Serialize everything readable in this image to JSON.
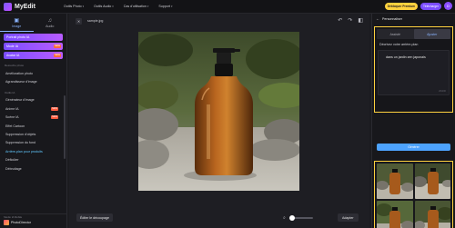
{
  "app": {
    "name": "MyEdit"
  },
  "nav": [
    {
      "label": "Outils Photo"
    },
    {
      "label": "Outils Audio"
    },
    {
      "label": "Cas d'utilisation"
    },
    {
      "label": "Support"
    }
  ],
  "top_actions": {
    "premium": "Débloquer Premium",
    "download": "Télécharger",
    "avatar_initial": "D"
  },
  "sidebar": {
    "tabs": [
      {
        "label": "Image",
        "icon": "image-icon",
        "active": true
      },
      {
        "label": "Audio",
        "icon": "audio-icon",
        "active": false
      }
    ],
    "highlights": [
      {
        "label": "Portrait photo IA",
        "badge": ""
      },
      {
        "label": "Mode IA",
        "badge": "NEW"
      },
      {
        "label": "Avatar IA",
        "badge": "NEW"
      }
    ],
    "section_retouche": "Retouche photo",
    "retouche_items": [
      {
        "label": "Amélioration photo"
      },
      {
        "label": "Agrandisseur d'image"
      }
    ],
    "section_ia": "Outils IA",
    "ia_items": [
      {
        "label": "Générateur d'image",
        "badge": "",
        "active": false
      },
      {
        "label": "Anime IA",
        "badge": "NEW",
        "active": false
      },
      {
        "label": "Scène IA",
        "badge": "NEW",
        "active": false
      },
      {
        "label": "Effet Cartoon",
        "badge": "",
        "active": false
      },
      {
        "label": "Suppression d'objets",
        "badge": "",
        "active": false
      },
      {
        "label": "Suppression du fond",
        "badge": "",
        "active": false
      },
      {
        "label": "Arrière-plan pour produits",
        "badge": "",
        "active": true
      },
      {
        "label": "Défloûter",
        "badge": "",
        "active": false
      },
      {
        "label": "Débruitage",
        "badge": "",
        "active": false
      }
    ],
    "footer_label": "Studio IA Mobile",
    "footer_app": "PhotoDirector"
  },
  "editor": {
    "file_name": "sample.jpg",
    "edit_crop_label": "Éditer le découpage",
    "apply_label": "Adapter",
    "zoom_value": 0.0
  },
  "right_panel": {
    "title": "Personnaliser",
    "tabs": [
      {
        "label": "Assisté",
        "active": false
      },
      {
        "label": "Ajuster",
        "active": true
      }
    ],
    "prompt_label": "Décrivez votre arrière-plan",
    "prompt_value": "dans un jardin zen japonais",
    "char_count": "26/200",
    "generate_label": "Générer"
  },
  "colors": {
    "accent": "#7b4dff",
    "highlight_border": "#ffd23f",
    "link": "#62c9ff",
    "generate": "#4da3ff"
  }
}
